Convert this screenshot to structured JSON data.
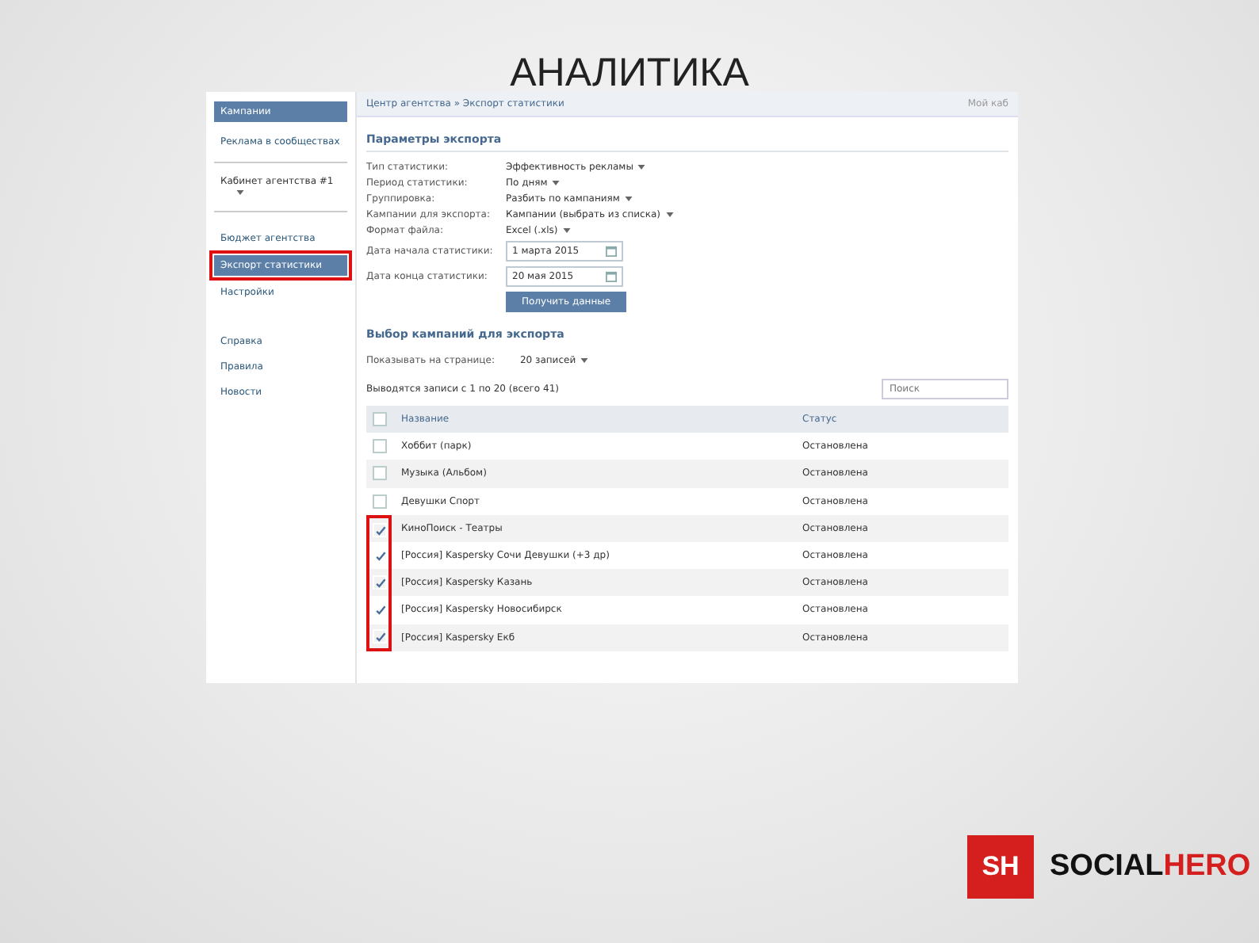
{
  "slide_title": "АНАЛИТИКА",
  "sidebar": {
    "items": [
      {
        "label": "Кампании",
        "kind": "header"
      },
      {
        "label": "Реклама в сообществах",
        "selected": false,
        "kind": "link"
      },
      {
        "label": "Кабинет агентства #1",
        "selected": false,
        "kind": "dropdown"
      },
      {
        "label": "Бюджет агентства",
        "selected": false,
        "kind": "link"
      },
      {
        "label": "Экспорт статистики",
        "selected": true,
        "kind": "link"
      },
      {
        "label": "Настройки",
        "selected": false,
        "kind": "link"
      },
      {
        "label": "Справка",
        "selected": false,
        "kind": "link"
      },
      {
        "label": "Правила",
        "selected": false,
        "kind": "link"
      },
      {
        "label": "Новости",
        "selected": false,
        "kind": "link"
      }
    ]
  },
  "breadcrumb": "Центр агентства » Экспорт статистики",
  "top_link": "Мой каб",
  "export_params": {
    "title": "Параметры экспорта",
    "rows": [
      {
        "label": "Тип статистики:",
        "value": "Эффективность рекламы",
        "kind": "select"
      },
      {
        "label": "Период статистики:",
        "value": "По дням",
        "kind": "select"
      },
      {
        "label": "Группировка:",
        "value": "Разбить по кампаниям",
        "kind": "select"
      },
      {
        "label": "Кампании для экспорта:",
        "value": "Кампании (выбрать из списка)",
        "kind": "select"
      },
      {
        "label": "Формат файла:",
        "value": "Excel (.xls)",
        "kind": "select"
      },
      {
        "label": "Дата начала статистики:",
        "value": "1 марта 2015",
        "kind": "date"
      },
      {
        "label": "Дата конца статистики:",
        "value": "20 мая 2015",
        "kind": "date"
      }
    ],
    "button": "Получить данные"
  },
  "campaigns": {
    "title": "Выбор кампаний для экспорта",
    "per_page_label": "Показывать на странице:",
    "per_page_value": "20 записей",
    "summary": "Выводятся записи с 1 по 20 (всего 41)",
    "search": {
      "placeholder": "Поиск"
    },
    "select_all": {
      "checked": false
    },
    "columns": [
      "Название",
      "Статус"
    ],
    "rows": [
      {
        "name": "Хоббит (парк)",
        "status": "Остановлена",
        "checked": false
      },
      {
        "name": "Музыка (Альбом)",
        "status": "Остановлена",
        "checked": false
      },
      {
        "name": "Девушки Спорт",
        "status": "Остановлена",
        "checked": false
      },
      {
        "name": "КиноПоиск - Театры",
        "status": "Остановлена",
        "checked": true
      },
      {
        "name": "[Россия] Kaspersky Сочи Девушки (+3 др)",
        "status": "Остановлена",
        "checked": true
      },
      {
        "name": "[Россия] Kaspersky Казань",
        "status": "Остановлена",
        "checked": true
      },
      {
        "name": "[Россия] Kaspersky Новосибирск",
        "status": "Остановлена",
        "checked": true
      },
      {
        "name": "[Россия] Kaspersky Екб",
        "status": "Остановлена",
        "checked": true
      }
    ]
  },
  "logo": {
    "mark": "SH",
    "word_1": "SOCIAL",
    "word_2": "HERO"
  }
}
